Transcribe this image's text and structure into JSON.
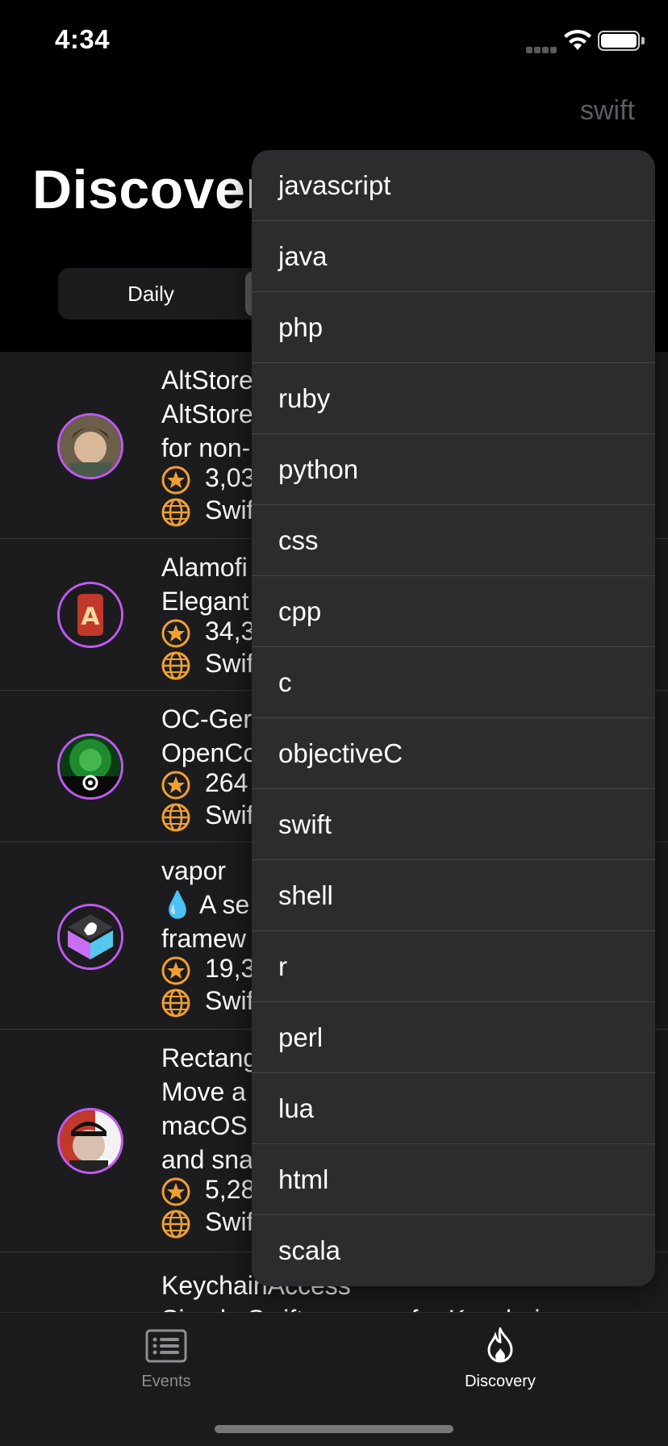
{
  "status_bar": {
    "time": "4:34"
  },
  "nav": {
    "language_button": "swift",
    "title": "Discover"
  },
  "segmented": {
    "daily": "Daily",
    "weekly": ""
  },
  "repos": [
    {
      "name": "AltStore",
      "lines": [
        "AltStore",
        "for non-"
      ],
      "stars": "3,03",
      "language": "Swift"
    },
    {
      "name": "Alamofi",
      "lines": [
        "Elegant"
      ],
      "stars": "34,3",
      "language": "Swift"
    },
    {
      "name": "OC-Ger",
      "lines": [
        "OpenCo"
      ],
      "stars": "264",
      "language": "Swift"
    },
    {
      "name": "vapor",
      "lines": [
        "💧 A se",
        "framew"
      ],
      "stars": "19,3",
      "language": "Swift"
    },
    {
      "name": "Rectang",
      "lines": [
        "Move a",
        "macOS",
        "and sna"
      ],
      "stars": "5,28",
      "language": "Swift"
    },
    {
      "name": "KeychainAccess",
      "lines": [
        "Simple Swift wrapper for Keychain"
      ],
      "stars": "",
      "language": ""
    }
  ],
  "dropdown": {
    "items": [
      "javascript",
      "java",
      "php",
      "ruby",
      "python",
      "css",
      "cpp",
      "c",
      "objectiveC",
      "swift",
      "shell",
      "r",
      "perl",
      "lua",
      "html",
      "scala"
    ]
  },
  "tabs": {
    "events": "Events",
    "discovery": "Discovery"
  },
  "colors": {
    "accent": "#bf5af2",
    "star": "#f0a030",
    "background": "#1c1c1e"
  }
}
